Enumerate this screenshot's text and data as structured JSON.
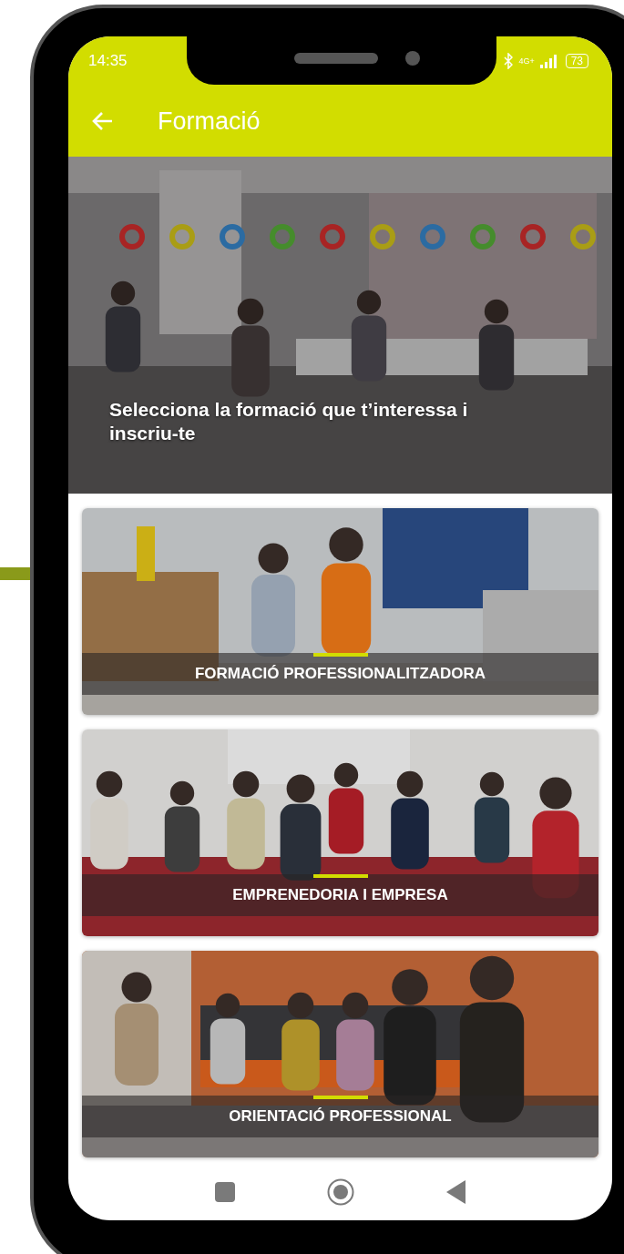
{
  "status_bar": {
    "time": "14:35",
    "network": "4G+",
    "battery": "73"
  },
  "app_bar": {
    "title": "Formació"
  },
  "hero": {
    "caption": "Selecciona la formació que t’interessa i inscriu-te"
  },
  "cards": [
    {
      "title": "FORMACIÓ PROFESSIONALITZADORA"
    },
    {
      "title": "EMPRENEDORIA I EMPRESA"
    },
    {
      "title": "ORIENTACIÓ PROFESSIONAL"
    }
  ]
}
